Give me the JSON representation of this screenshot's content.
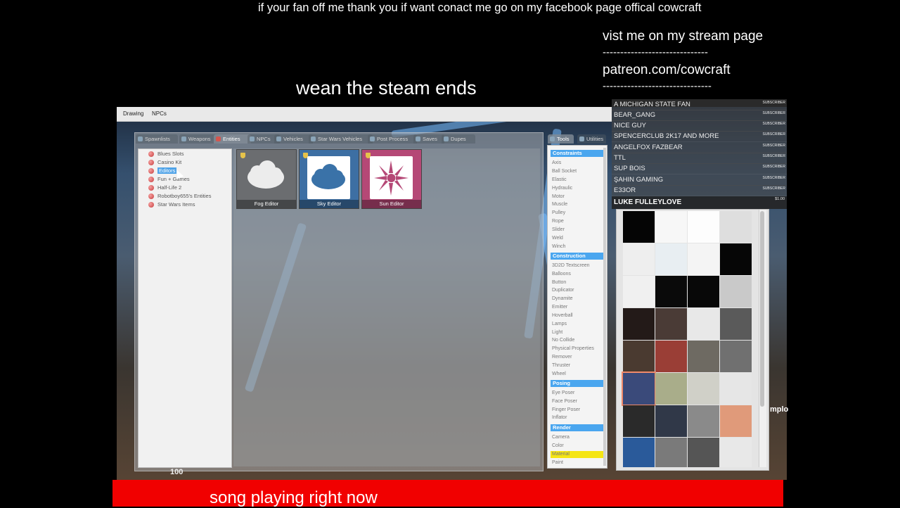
{
  "overlay": {
    "top_banner": "if your fan off me thank you if want conact me go on my facebook page offical cowcraft",
    "stream_line": "vist me on my stream page",
    "dashes_1": "------------------------------",
    "patreon": "patreon.com/cowcraft",
    "dashes_2": "-------------------------------",
    "wean": "wean the steam ends",
    "song": "song playing right now"
  },
  "menubar": {
    "items": [
      "Drawing",
      "NPCs"
    ]
  },
  "spawn_tabs": [
    "Spawnlists",
    "Weapons",
    "Entities",
    "NPCs",
    "Vehicles",
    "Star Wars Vehicles",
    "Post Process",
    "Saves",
    "Dupes"
  ],
  "tree": {
    "items": [
      "Blues Slots",
      "Casino Kit",
      "Editors",
      "Fun + Games",
      "Half-Life 2",
      "Robotboy655's Entities",
      "Star Wars Items"
    ],
    "selected": "Editors"
  },
  "tiles": [
    {
      "label": "Fog Editor"
    },
    {
      "label": "Sky Editor"
    },
    {
      "label": "Sun Editor"
    }
  ],
  "tools_tabs": [
    "Tools",
    "Utilities"
  ],
  "tools": {
    "constraints_label": "Constraints",
    "constraints": [
      "Axis",
      "Ball Socket",
      "Elastic",
      "Hydraulic",
      "Motor",
      "Muscle",
      "Pulley",
      "Rope",
      "Slider",
      "Weld",
      "Winch"
    ],
    "construction_label": "Construction",
    "construction": [
      "3D2D Textscreen",
      "Balloons",
      "Button",
      "Duplicator",
      "Dynamite",
      "Emitter",
      "Hoverball",
      "Lamps",
      "Light",
      "No Collide",
      "Physical Properties",
      "Remover",
      "Thruster",
      "Wheel"
    ],
    "posing_label": "Posing",
    "posing": [
      "Eye Poser",
      "Face Poser",
      "Finger Poser",
      "Inflator"
    ],
    "render_label": "Render",
    "render": [
      "Camera",
      "Color",
      "Material",
      "Paint"
    ],
    "highlighted": "Material"
  },
  "subscribers": {
    "tag": "SUBSCRIBER",
    "names": [
      "A MICHIGAN STATE FAN",
      "BEAR_GANG",
      "NICE GUY",
      "SPENCERCLUB 2K17 AND MORE",
      "ANGELFOX FAZBEAR",
      "TTL",
      "SUP BOIS",
      "ŞAHIN GAMING",
      "E33OR"
    ],
    "donor_name": "LUKE FULLEYLOVE",
    "donor_amount": "$1.00"
  },
  "hud": {
    "health": "100",
    "side_text": "mplo"
  },
  "colors": {
    "accent": "#4aa6ef",
    "highlight": "#f5e514",
    "bottom_bar": "#f10000",
    "fog_tile": "#6b6d70",
    "sky_tile": "#3d6fa3",
    "sun_tile": "#b54876"
  }
}
